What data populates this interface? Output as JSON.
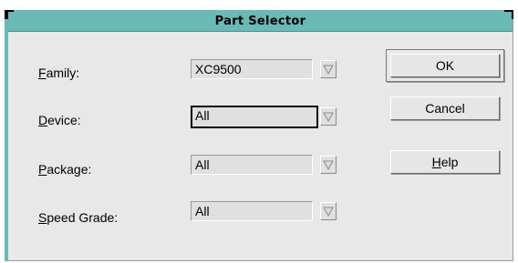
{
  "dialog": {
    "title": "Part Selector"
  },
  "fields": [
    {
      "label_mnemonic": "F",
      "label_rest": "amily:",
      "value": "XC9500"
    },
    {
      "label_mnemonic": "D",
      "label_rest": "evice:",
      "value": "All"
    },
    {
      "label_mnemonic": "P",
      "label_rest": "ackage:",
      "value": "All"
    },
    {
      "label_mnemonic": "S",
      "label_rest": "peed Grade:",
      "value": "All"
    }
  ],
  "buttons": {
    "ok": "OK",
    "cancel": "Cancel",
    "help_mnemonic": "H",
    "help_rest": "elp"
  },
  "icons": {
    "dropdown": "chevron-down-icon"
  }
}
